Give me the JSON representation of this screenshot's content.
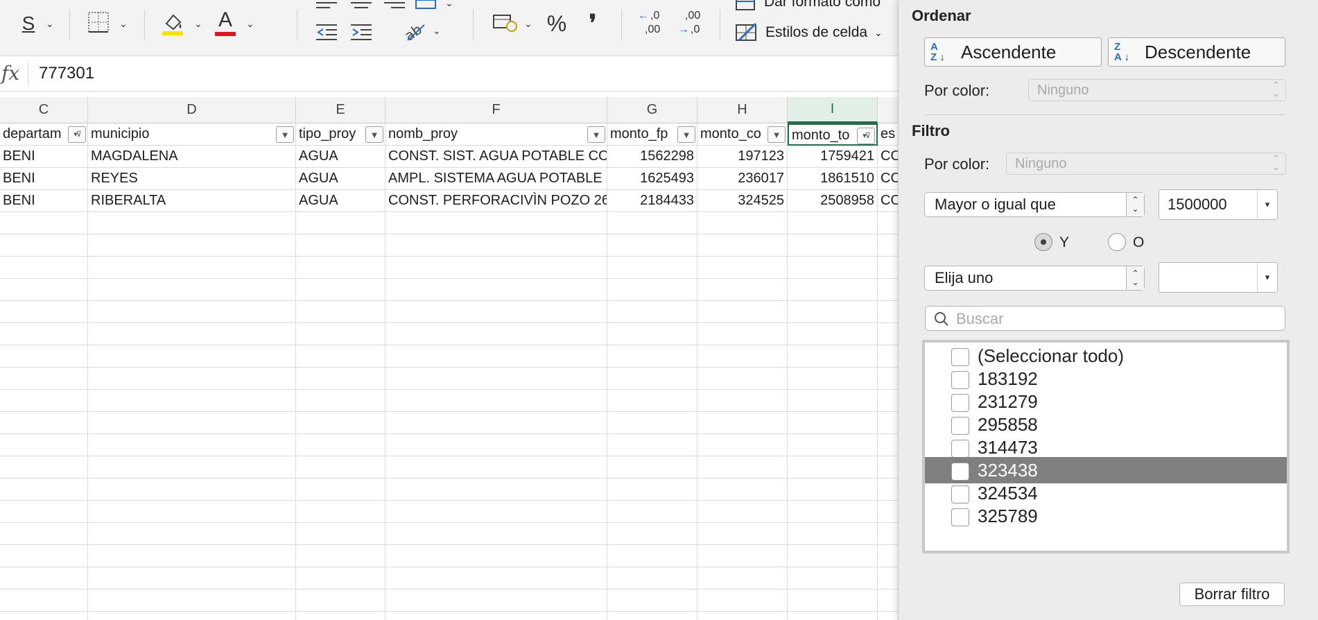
{
  "ribbon": {
    "underline_label": "S",
    "font_color_label": "A",
    "percent_label": "%",
    "comma_label": "❜",
    "increase_decimal_label": ",0",
    "increase_decimal_sub": ",00",
    "decrease_decimal_label": ",00",
    "decrease_decimal_sub": ",0",
    "format_as_table_label": "Dar formato como",
    "cell_styles_label": "Estilos de celda",
    "accent_colors": {
      "highlight": "#f5e500",
      "font": "#e3141b",
      "blue_icon": "#2b6cc4",
      "selection": "#1e7145"
    }
  },
  "formula_bar": {
    "fx_label": "fx",
    "value": "777301"
  },
  "grid": {
    "column_letters": [
      "C",
      "D",
      "E",
      "F",
      "G",
      "H",
      "I",
      ""
    ],
    "headers": [
      "departam",
      "municipio",
      "tipo_proy",
      "nomb_proy",
      "monto_fp",
      "monto_co",
      "monto_to",
      "es"
    ],
    "rows": [
      [
        "BENI",
        "MAGDALENA",
        "AGUA",
        "CONST. SIST. AGUA POTABLE CO",
        "1562298",
        "197123",
        "1759421",
        "CO"
      ],
      [
        "BENI",
        "REYES",
        "AGUA",
        "AMPL. SISTEMA AGUA POTABLE",
        "1625493",
        "236017",
        "1861510",
        "CO"
      ],
      [
        "BENI",
        "RIBERALTA",
        "AGUA",
        "CONST. PERFORACIVÌN POZO 26",
        "2184433",
        "324525",
        "2508958",
        "CO"
      ]
    ]
  },
  "panel": {
    "sort_title": "Ordenar",
    "ascending_label": "Ascendente",
    "descending_label": "Descendente",
    "sort_by_color_label": "Por color:",
    "sort_color_value": "Ninguno",
    "filter_title": "Filtro",
    "filter_by_color_label": "Por color:",
    "filter_color_value": "Ninguno",
    "condition1": "Mayor o igual que",
    "value1": "1500000",
    "and_label": "Y",
    "or_label": "O",
    "condition2": "Elija uno",
    "value2": "",
    "search_placeholder": "Buscar",
    "list_items": [
      "(Seleccionar todo)",
      "183192",
      "231279",
      "295858",
      "314473",
      "323438",
      "324534",
      "325789"
    ],
    "highlighted_item": "323438",
    "clear_filter_label": "Borrar filtro"
  }
}
